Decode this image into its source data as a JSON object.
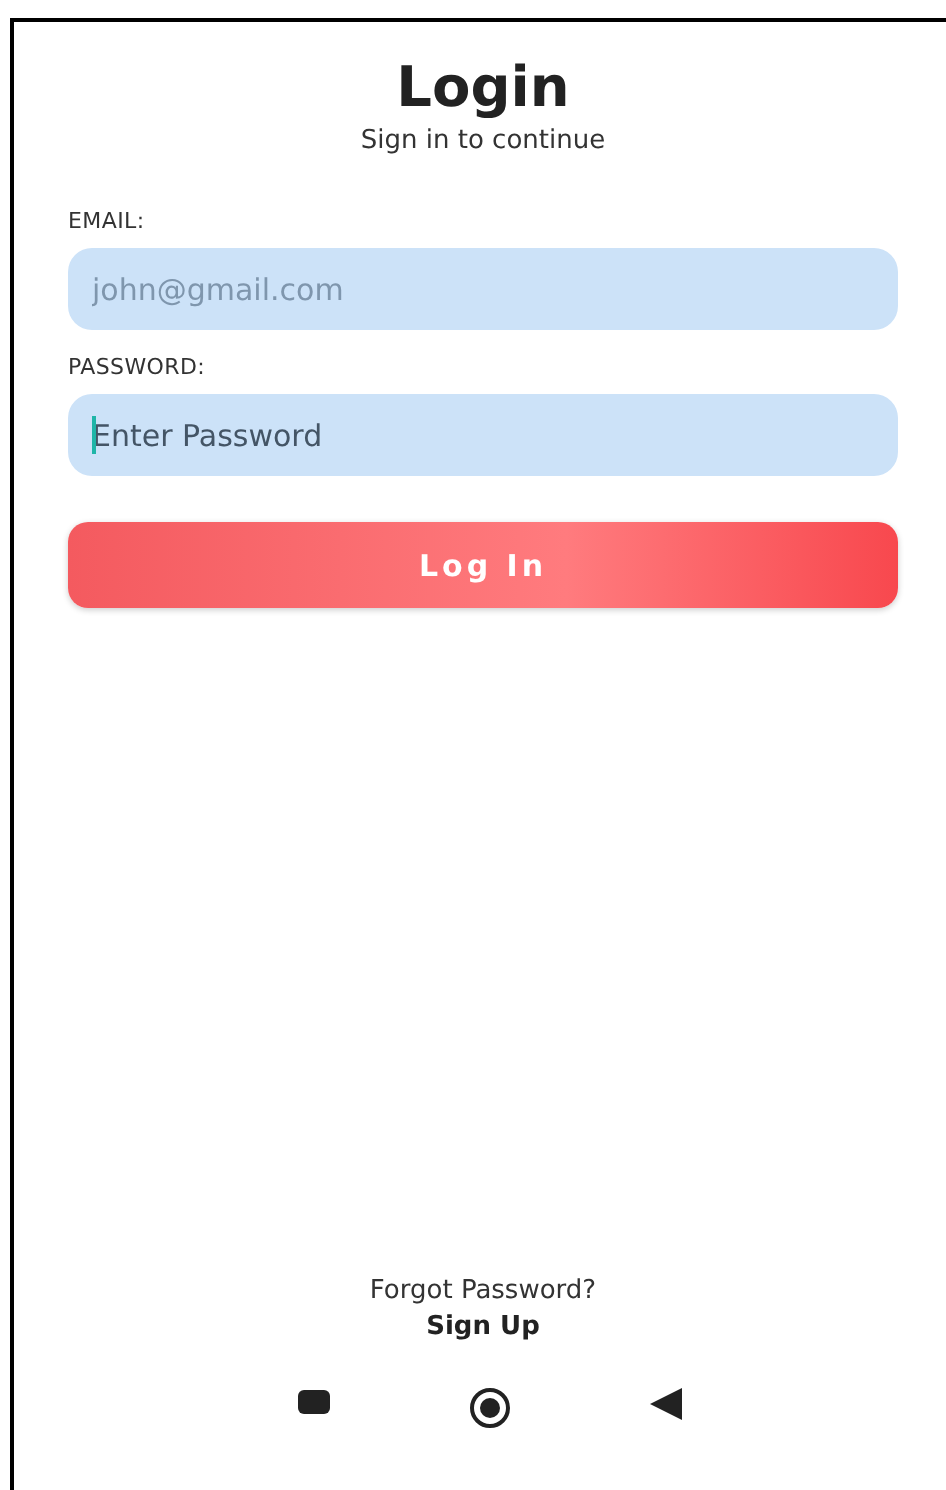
{
  "header": {
    "title": "Login",
    "subtitle": "Sign in to continue"
  },
  "fields": [
    {
      "label": "EMAIL:",
      "placeholder": "john@gmail.com",
      "focused": false
    },
    {
      "label": "PASSWORD:",
      "placeholder": "Enter Password",
      "focused": true
    }
  ],
  "login_button": "Log In",
  "footer": {
    "forgot_link": "Forgot Password?",
    "signup_link": "Sign Up"
  },
  "nav_bar": [
    {
      "kind": "recents"
    },
    {
      "kind": "home"
    },
    {
      "kind": "back"
    }
  ]
}
